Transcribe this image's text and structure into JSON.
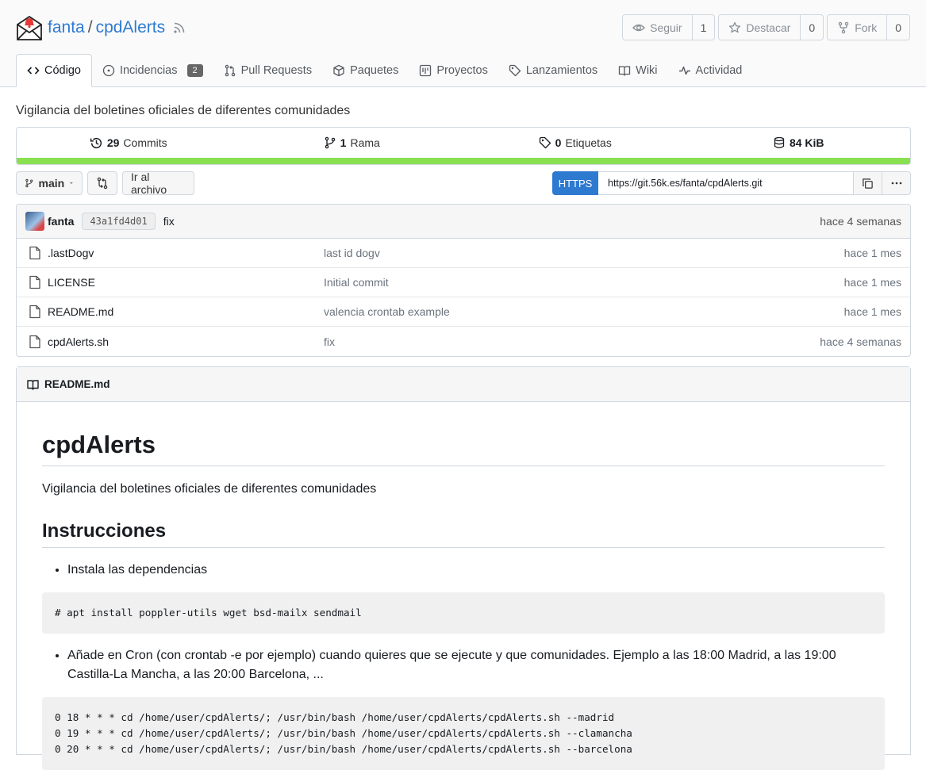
{
  "repo": {
    "owner": "fanta",
    "separator": "/",
    "name": "cpdAlerts",
    "description": "Vigilancia del boletines oficiales de diferentes comunidades"
  },
  "actions": {
    "watch_label": "Seguir",
    "watch_count": "1",
    "star_label": "Destacar",
    "star_count": "0",
    "fork_label": "Fork",
    "fork_count": "0"
  },
  "tabs": [
    {
      "label": "Código"
    },
    {
      "label": "Incidencias",
      "badge": "2"
    },
    {
      "label": "Pull Requests"
    },
    {
      "label": "Paquetes"
    },
    {
      "label": "Proyectos"
    },
    {
      "label": "Lanzamientos"
    },
    {
      "label": "Wiki"
    },
    {
      "label": "Actividad"
    }
  ],
  "stats": {
    "commits_count": "29",
    "commits_label": "Commits",
    "branches_count": "1",
    "branches_label": "Rama",
    "tags_count": "0",
    "tags_label": "Etiquetas",
    "size": "84 KiB"
  },
  "language_color": "#89e051",
  "toolbar": {
    "branch": "main",
    "go_to_file": "Ir al archivo",
    "clone_protocol": "HTTPS",
    "clone_url": "https://git.56k.es/fanta/cpdAlerts.git"
  },
  "last_commit": {
    "author": "fanta",
    "sha": "43a1fd4d01",
    "message": "fix",
    "time": "hace 4 semanas"
  },
  "files": [
    {
      "name": ".lastDogv",
      "message": "last id dogv",
      "time": "hace 1 mes"
    },
    {
      "name": "LICENSE",
      "message": "Initial commit",
      "time": "hace 1 mes"
    },
    {
      "name": "README.md",
      "message": "valencia crontab example",
      "time": "hace 1 mes"
    },
    {
      "name": "cpdAlerts.sh",
      "message": "fix",
      "time": "hace 4 semanas"
    }
  ],
  "readme": {
    "filename": "README.md",
    "title": "cpdAlerts",
    "intro": "Vigilancia del boletines oficiales de diferentes comunidades",
    "h2": "Instrucciones",
    "step1": "Instala las dependencias",
    "code1": "# apt install poppler-utils wget bsd-mailx sendmail",
    "step2": "Añade en Cron (con crontab -e por ejemplo) cuando quieres que se ejecute y que comunidades. Ejemplo a las 18:00 Madrid, a las 19:00 Castilla-La Mancha, a las 20:00 Barcelona, ...",
    "code2": "0 18 * * * cd /home/user/cpdAlerts/; /usr/bin/bash /home/user/cpdAlerts/cpdAlerts.sh --madrid\n0 19 * * * cd /home/user/cpdAlerts/; /usr/bin/bash /home/user/cpdAlerts/cpdAlerts.sh --clamancha\n0 20 * * * cd /home/user/cpdAlerts/; /usr/bin/bash /home/user/cpdAlerts/cpdAlerts.sh --barcelona"
  }
}
